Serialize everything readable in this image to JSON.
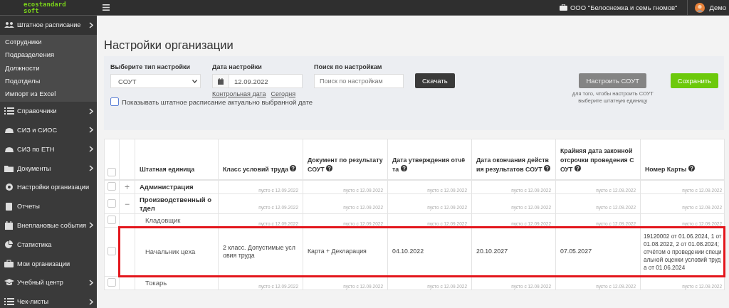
{
  "topbar": {
    "logo": [
      "ecostandard",
      "soft"
    ],
    "organization": "ООО \"Белоснежка и семь гномов\"",
    "user": "Демо"
  },
  "sidebar": {
    "items": [
      {
        "label": "Штатное расписание",
        "has_submenu": true,
        "expanded": true,
        "children": [
          {
            "label": "Сотрудники"
          },
          {
            "label": "Подразделения"
          },
          {
            "label": "Должности"
          },
          {
            "label": "Подотделы"
          },
          {
            "label": "Импорт из Excel"
          }
        ]
      },
      {
        "label": "Справочники",
        "has_submenu": true,
        "expanded": false
      },
      {
        "label": "СИЗ и СИОС",
        "has_submenu": true,
        "expanded": false
      },
      {
        "label": "СИЗ по ЕТН",
        "has_submenu": true,
        "expanded": false
      },
      {
        "label": "Документы",
        "has_submenu": true,
        "expanded": false
      },
      {
        "label": "Настройки организации",
        "has_submenu": false
      },
      {
        "label": "Отчеты",
        "has_submenu": false
      },
      {
        "label": "Внеплановые события",
        "has_submenu": true,
        "expanded": false
      },
      {
        "label": "Статистика",
        "has_submenu": false
      },
      {
        "label": "Мои организации",
        "has_submenu": false
      },
      {
        "label": "Учебный центр",
        "has_submenu": true,
        "expanded": false
      },
      {
        "label": "Чек-листы",
        "has_submenu": true,
        "expanded": false
      }
    ]
  },
  "page_title": "Настройки организации",
  "filters": {
    "type_label": "Выберите тип настройки",
    "type_value": "СОУТ",
    "date_label": "Дата настройки",
    "date_value": "12.09.2022",
    "date_links": [
      "Контрольная дата",
      "Сегодня"
    ],
    "search_label": "Поиск по настройкам",
    "search_placeholder": "Поиск по настройкам",
    "download_button": "Скачать",
    "configure_button": {
      "label": "Настроить СОУТ",
      "disabled": true
    },
    "configure_hint": "для того, чтобы настроить СОУТ выберите штатную единицу",
    "save_button": "Сохранить",
    "show_checkbox": {
      "label": "Показывать штатное расписание актуально выбранной дате",
      "checked": false
    }
  },
  "table": {
    "header_checked": false,
    "columns": [
      {
        "label": "Штатная единица",
        "help": false
      },
      {
        "label": "Класс условий труда",
        "help": true
      },
      {
        "label": "Документ по результату СОУТ",
        "help": true
      },
      {
        "label": "Дата утверждения отчёта",
        "help": true
      },
      {
        "label": "Дата окончания действия результатов СОУТ",
        "help": true
      },
      {
        "label": "Крайняя дата законной отсрочки проведения СОУТ",
        "help": true
      },
      {
        "label": "Номер Карты",
        "help": true
      }
    ],
    "rows": [
      {
        "kind": "group",
        "checked": false,
        "toggle": "+",
        "highlighted": false,
        "cells": [
          {
            "value": "Администрация"
          },
          {
            "note": "пусто с 12.09.2022"
          },
          {
            "note": "пусто с 12.09.2022"
          },
          {
            "note": "пусто с 12.09.2022"
          },
          {
            "note": "пусто с 12.09.2022"
          },
          {
            "note": "пусто с 12.09.2022"
          },
          {
            "note": "пусто с 12.09.2022"
          }
        ]
      },
      {
        "kind": "group",
        "checked": false,
        "toggle": "−",
        "highlighted": false,
        "cells": [
          {
            "value": "Производственный отдел"
          },
          {
            "note": "пусто с 12.09.2022"
          },
          {
            "note": "пусто с 12.09.2022"
          },
          {
            "note": "пусто с 12.09.2022"
          },
          {
            "note": "пусто с 12.09.2022"
          },
          {
            "note": "пусто с 12.09.2022"
          },
          {
            "note": "пусто с 12.09.2022"
          }
        ]
      },
      {
        "kind": "item",
        "checked": false,
        "highlighted": false,
        "cells": [
          {
            "value": "Кладовщик"
          },
          {
            "note": "пусто с 12.09.2022"
          },
          {
            "note": "пусто с 12.09.2022"
          },
          {
            "note": "пусто с 12.09.2022"
          },
          {
            "note": "пусто с 12.09.2022"
          },
          {
            "note": "пусто с 12.09.2022"
          },
          {
            "note": "пусто с 12.09.2022"
          }
        ]
      },
      {
        "kind": "item",
        "checked": false,
        "highlighted": true,
        "cells": [
          {
            "value": "Начальник цеха"
          },
          {
            "value": "2 класс. Допустимые условия труда"
          },
          {
            "value": "Карта + Декларация"
          },
          {
            "value": "04.10.2022"
          },
          {
            "value": "20.10.2027"
          },
          {
            "value": "07.05.2027"
          },
          {
            "value": "19120002 от 01.06.2024, 1 от 01.08.2022, 2 от 01.08.2024; отчётом о проведении специальной оценки условий труда от 01.06.2024"
          }
        ]
      },
      {
        "kind": "item",
        "checked": false,
        "highlighted": false,
        "cells": [
          {
            "value": "Токарь"
          },
          {
            "note": "пусто с 12.09.2022"
          },
          {
            "note": "пусто с 12.09.2022"
          },
          {
            "note": "пусто с 12.09.2022"
          },
          {
            "note": "пусто с 12.09.2022"
          },
          {
            "note": "пусто с 12.09.2022"
          },
          {
            "note": "пусто с 12.09.2022"
          }
        ]
      }
    ]
  }
}
